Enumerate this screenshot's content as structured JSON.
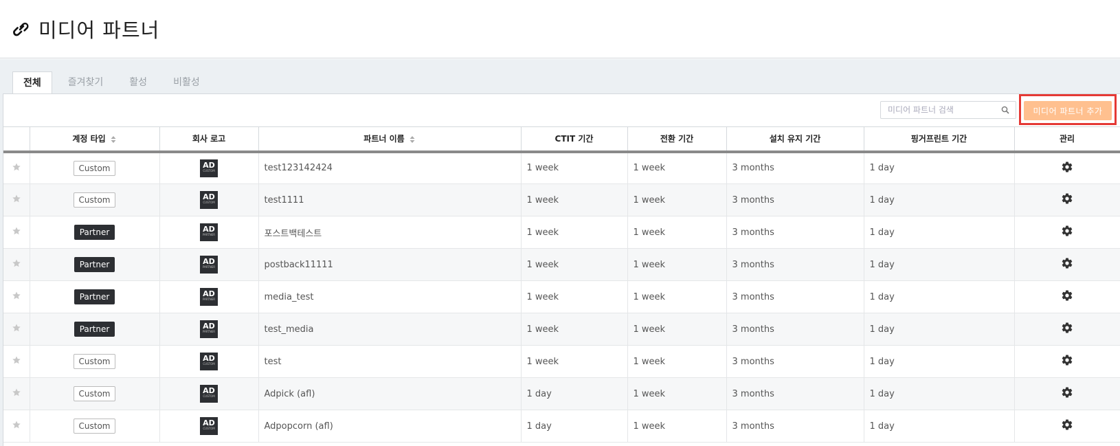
{
  "page": {
    "title": "미디어 파트너"
  },
  "tabs": [
    {
      "label": "전체",
      "active": true
    },
    {
      "label": "즐겨찾기",
      "active": false
    },
    {
      "label": "활성",
      "active": false
    },
    {
      "label": "비활성",
      "active": false
    }
  ],
  "toolbar": {
    "search_placeholder": "미디어 파트너 검색",
    "add_label": "미디어 파트너 추가"
  },
  "columns": {
    "account_type": "계정 타입",
    "company_logo": "회사 로고",
    "partner_name": "파트너 이름",
    "ctit": "CTIT 기간",
    "conversion": "전환 기간",
    "install_retention": "설치 유지 기간",
    "fingerprint": "핑거프린트 기간",
    "manage": "관리"
  },
  "rows": [
    {
      "type": "Custom",
      "logo_big": "AD",
      "logo_small": "CUSTOM",
      "name": "test123142424",
      "ctit": "1 week",
      "conversion": "1 week",
      "install": "3 months",
      "fingerprint": "1 day"
    },
    {
      "type": "Custom",
      "logo_big": "AD",
      "logo_small": "CUSTOM",
      "name": "test1111",
      "ctit": "1 week",
      "conversion": "1 week",
      "install": "3 months",
      "fingerprint": "1 day"
    },
    {
      "type": "Partner",
      "logo_big": "AD",
      "logo_small": "PARTNER",
      "name": "포스트백테스트",
      "ctit": "1 week",
      "conversion": "1 week",
      "install": "3 months",
      "fingerprint": "1 day"
    },
    {
      "type": "Partner",
      "logo_big": "AD",
      "logo_small": "PARTNER",
      "name": "postback11111",
      "ctit": "1 week",
      "conversion": "1 week",
      "install": "3 months",
      "fingerprint": "1 day"
    },
    {
      "type": "Partner",
      "logo_big": "AD",
      "logo_small": "PARTNER",
      "name": "media_test",
      "ctit": "1 week",
      "conversion": "1 week",
      "install": "3 months",
      "fingerprint": "1 day"
    },
    {
      "type": "Partner",
      "logo_big": "AD",
      "logo_small": "PARTNER",
      "name": "test_media",
      "ctit": "1 week",
      "conversion": "1 week",
      "install": "3 months",
      "fingerprint": "1 day"
    },
    {
      "type": "Custom",
      "logo_big": "AD",
      "logo_small": "CUSTOM",
      "name": "test",
      "ctit": "1 week",
      "conversion": "1 week",
      "install": "3 months",
      "fingerprint": "1 day"
    },
    {
      "type": "Custom",
      "logo_big": "AD",
      "logo_small": "CUSTOM",
      "name": "Adpick (afl)",
      "ctit": "1 day",
      "conversion": "1 week",
      "install": "3 months",
      "fingerprint": "1 day"
    },
    {
      "type": "Custom",
      "logo_big": "AD",
      "logo_small": "CUSTOM",
      "name": "Adpopcorn (afl)",
      "ctit": "1 day",
      "conversion": "1 week",
      "install": "3 months",
      "fingerprint": "1 day"
    }
  ],
  "colors": {
    "accent": "#ffc08f",
    "highlight": "#e53935",
    "partner_badge": "#2d2f33"
  }
}
